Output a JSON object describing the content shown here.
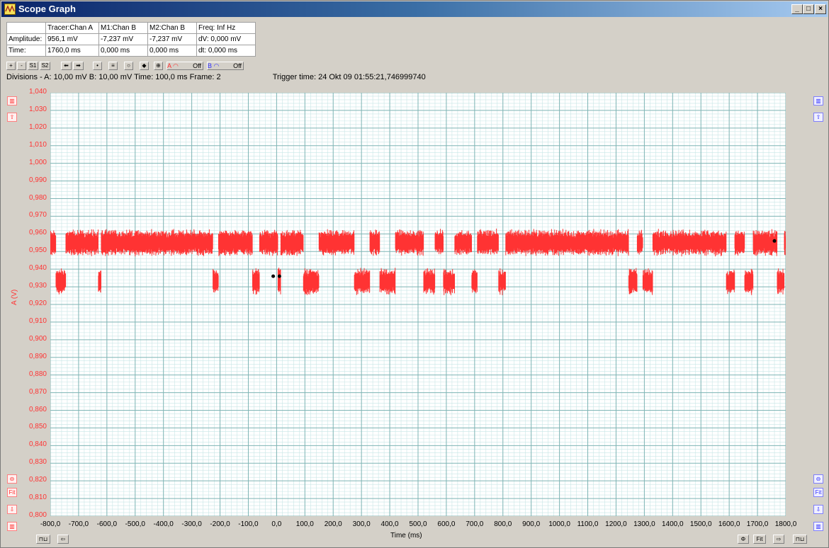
{
  "window": {
    "title": "Scope Graph",
    "min_label": "_",
    "max_label": "□",
    "close_label": "×"
  },
  "info_table": {
    "header": [
      "",
      "Tracer:Chan A",
      "M1:Chan B",
      "M2:Chan B",
      "Freq: Inf Hz"
    ],
    "rows": [
      [
        "Amplitude:",
        "956,1 mV",
        "-7,237 mV",
        "-7,237 mV",
        "dV: 0,000 mV"
      ],
      [
        "Time:",
        "1760,0 ms",
        "0,000 ms",
        "0,000 ms",
        "dt: 0,000 ms"
      ]
    ]
  },
  "toolbar": {
    "plus": "+",
    "minus": "-",
    "s1": "S1",
    "s2": "S2",
    "left_arrow": "⬅",
    "right_arrow": "➡",
    "chan_a_label": "A",
    "chan_a_state": "Off",
    "chan_b_label": "B",
    "chan_b_state": "Off"
  },
  "status": {
    "divisions": "Divisions -  A: 10,00 mV   B: 10,00 mV   Time: 100,0 ms  Frame: 2",
    "trigger": "Trigger time: 24 Okt 09 01:55:21,746999740"
  },
  "side_buttons": {
    "fit": "Fit"
  },
  "colors": {
    "trace": "#ff3333",
    "grid_major": "#7fb5b5",
    "grid_minor": "#c8e6e6",
    "axis_label": "#ff3333"
  },
  "chart_data": {
    "type": "line",
    "ylabel": "A (V)",
    "xlabel": "Time (ms)",
    "xlim": [
      -800,
      1800
    ],
    "ylim": [
      0.8,
      1.04
    ],
    "x_ticks": [
      "-800,0",
      "-700,0",
      "-600,0",
      "-500,0",
      "-400,0",
      "-300,0",
      "-200,0",
      "-100,0",
      "0,0",
      "100,0",
      "200,0",
      "300,0",
      "400,0",
      "500,0",
      "600,0",
      "700,0",
      "800,0",
      "900,0",
      "1000,0",
      "1100,0",
      "1200,0",
      "1300,0",
      "1400,0",
      "1500,0",
      "1600,0",
      "1700,0",
      "1800,0"
    ],
    "y_ticks": [
      "1,040",
      "1,030",
      "1,020",
      "1,010",
      "1,000",
      "0,990",
      "0,980",
      "0,970",
      "0,960",
      "0,950",
      "0,940",
      "0,930",
      "0,920",
      "0,910",
      "0,900",
      "0,890",
      "0,880",
      "0,870",
      "0,860",
      "0,850",
      "0,840",
      "0,830",
      "0,820",
      "0,810",
      "0,800"
    ],
    "series": [
      {
        "high_level": 0.955,
        "low_level": 0.933,
        "noise": 0.008,
        "segments": [
          [
            -800,
            -780,
            "high"
          ],
          [
            -780,
            -745,
            "low"
          ],
          [
            -745,
            -630,
            "high"
          ],
          [
            -630,
            -620,
            "low"
          ],
          [
            -620,
            -225,
            "high"
          ],
          [
            -225,
            -205,
            "low"
          ],
          [
            -205,
            -85,
            "high"
          ],
          [
            -85,
            -60,
            "low"
          ],
          [
            -60,
            5,
            "high"
          ],
          [
            5,
            15,
            "low"
          ],
          [
            15,
            95,
            "high"
          ],
          [
            95,
            150,
            "low"
          ],
          [
            150,
            275,
            "high"
          ],
          [
            275,
            330,
            "low"
          ],
          [
            330,
            365,
            "high"
          ],
          [
            365,
            420,
            "low"
          ],
          [
            420,
            520,
            "high"
          ],
          [
            520,
            560,
            "low"
          ],
          [
            560,
            590,
            "high"
          ],
          [
            590,
            630,
            "low"
          ],
          [
            630,
            690,
            "high"
          ],
          [
            690,
            710,
            "low"
          ],
          [
            710,
            785,
            "high"
          ],
          [
            785,
            810,
            "low"
          ],
          [
            810,
            1245,
            "high"
          ],
          [
            1245,
            1275,
            "low"
          ],
          [
            1275,
            1295,
            "high"
          ],
          [
            1295,
            1330,
            "low"
          ],
          [
            1330,
            1590,
            "high"
          ],
          [
            1590,
            1620,
            "low"
          ],
          [
            1620,
            1655,
            "high"
          ],
          [
            1655,
            1685,
            "low"
          ],
          [
            1685,
            1770,
            "high"
          ],
          [
            1770,
            1795,
            "low"
          ],
          [
            1795,
            1800,
            "high"
          ]
        ]
      }
    ],
    "markers": [
      {
        "x": -12,
        "y": 0.936
      },
      {
        "x": 10,
        "y": 0.936
      },
      {
        "x": 1760,
        "y": 0.956
      }
    ]
  }
}
